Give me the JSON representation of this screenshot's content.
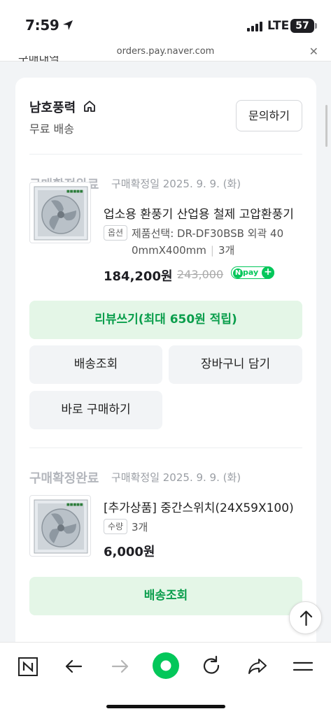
{
  "status_bar": {
    "time": "7:59",
    "network": "LTE",
    "battery": "57"
  },
  "browser": {
    "url": "orders.pay.naver.com",
    "close_icon": "close-icon"
  },
  "seller": {
    "name": "남호풍력",
    "shipping": "무료 배송",
    "inquiry_label": "문의하기"
  },
  "orders": [
    {
      "status": "구매확정완료",
      "confirm_date": "구매확정일 2025. 9. 9. (화)",
      "product_name": "업소용 환풍기 산업용 철제 고압환풍기",
      "option_tag": "옵션",
      "option_line1": "제품선택: DR-DF30BSB 외곽 40",
      "option_line2": "0mmX400mm",
      "quantity": "3개",
      "price": "184,200원",
      "original_price": "243,000",
      "npay_label": "pay",
      "buttons": {
        "review": "리뷰쓰기(최대 650원 적립)",
        "tracking": "배송조회",
        "cart": "장바구니 담기",
        "buy_now": "바로 구매하기"
      }
    },
    {
      "status": "구매확정완료",
      "confirm_date": "구매확정일 2025. 9. 9. (화)",
      "product_name": "[추가상품] 중간스위치(24X59X100)",
      "option_tag": "수량",
      "quantity": "3개",
      "price": "6,000원",
      "buttons": {
        "tracking": "배송조회"
      }
    }
  ],
  "colors": {
    "accent_green": "#03c75a",
    "button_green_bg": "#e4f6e7",
    "button_green_text": "#0a9e4c"
  }
}
